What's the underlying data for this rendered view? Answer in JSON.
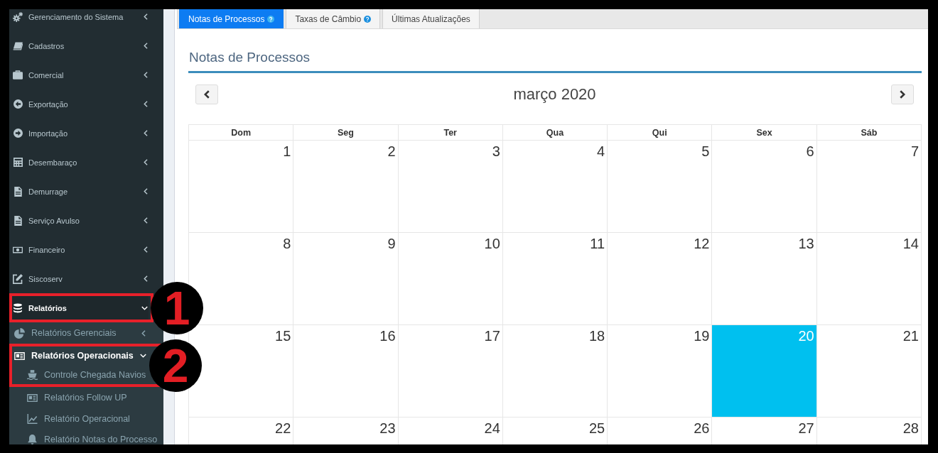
{
  "sidebar": {
    "items": [
      {
        "label": "Gerenciamento do Sistema",
        "expanded": false,
        "selected": false
      },
      {
        "label": "Cadastros",
        "expanded": false,
        "selected": false
      },
      {
        "label": "Comercial",
        "expanded": false,
        "selected": false
      },
      {
        "label": "Exportação",
        "expanded": false,
        "selected": false
      },
      {
        "label": "Importação",
        "expanded": false,
        "selected": false
      },
      {
        "label": "Desembaraço",
        "expanded": false,
        "selected": false
      },
      {
        "label": "Demurrage",
        "expanded": false,
        "selected": false
      },
      {
        "label": "Serviço Avulso",
        "expanded": false,
        "selected": false
      },
      {
        "label": "Financeiro",
        "expanded": false,
        "selected": false
      },
      {
        "label": "Siscoserv",
        "expanded": false,
        "selected": false
      },
      {
        "label": "Relatórios",
        "expanded": true,
        "selected": true,
        "children": [
          {
            "label": "Relatórios Gerenciais",
            "expanded": false,
            "selected": false
          },
          {
            "label": "Relatórios Operacionais",
            "expanded": true,
            "selected": true,
            "children": [
              {
                "label": "Controle Chegada Navios",
                "selected": false
              },
              {
                "label": "Relatórios Follow UP",
                "selected": false
              },
              {
                "label": "Relatório Operacional",
                "selected": false
              },
              {
                "label": "Relatório Notas do Processo",
                "selected": false
              }
            ]
          }
        ]
      }
    ]
  },
  "tabs": [
    {
      "label": "Notas de Processos",
      "selected": true,
      "help": true
    },
    {
      "label": "Taxas de Câmbio",
      "selected": false,
      "help": true
    },
    {
      "label": "Últimas Atualizações",
      "selected": false,
      "help": false
    }
  ],
  "panel": {
    "title": "Notas de Processos"
  },
  "calendar": {
    "title": "março 2020",
    "weekdays": [
      "Dom",
      "Seg",
      "Ter",
      "Qua",
      "Qui",
      "Sex",
      "Sáb"
    ],
    "weeks": [
      [
        {
          "day": "1",
          "today": false
        },
        {
          "day": "2",
          "today": false
        },
        {
          "day": "3",
          "today": false
        },
        {
          "day": "4",
          "today": false
        },
        {
          "day": "5",
          "today": false
        },
        {
          "day": "6",
          "today": false
        },
        {
          "day": "7",
          "today": false
        }
      ],
      [
        {
          "day": "8",
          "today": false
        },
        {
          "day": "9",
          "today": false
        },
        {
          "day": "10",
          "today": false
        },
        {
          "day": "11",
          "today": false
        },
        {
          "day": "12",
          "today": false
        },
        {
          "day": "13",
          "today": false
        },
        {
          "day": "14",
          "today": false
        }
      ],
      [
        {
          "day": "15",
          "today": false
        },
        {
          "day": "16",
          "today": false
        },
        {
          "day": "17",
          "today": false
        },
        {
          "day": "18",
          "today": false
        },
        {
          "day": "19",
          "today": false
        },
        {
          "day": "20",
          "today": true
        },
        {
          "day": "21",
          "today": false
        }
      ],
      [
        {
          "day": "22",
          "today": false
        },
        {
          "day": "23",
          "today": false
        },
        {
          "day": "24",
          "today": false
        },
        {
          "day": "25",
          "today": false
        },
        {
          "day": "26",
          "today": false
        },
        {
          "day": "27",
          "today": false
        },
        {
          "day": "28",
          "today": false
        }
      ]
    ]
  },
  "annotations": [
    {
      "label": "1"
    },
    {
      "label": "2"
    }
  ]
}
